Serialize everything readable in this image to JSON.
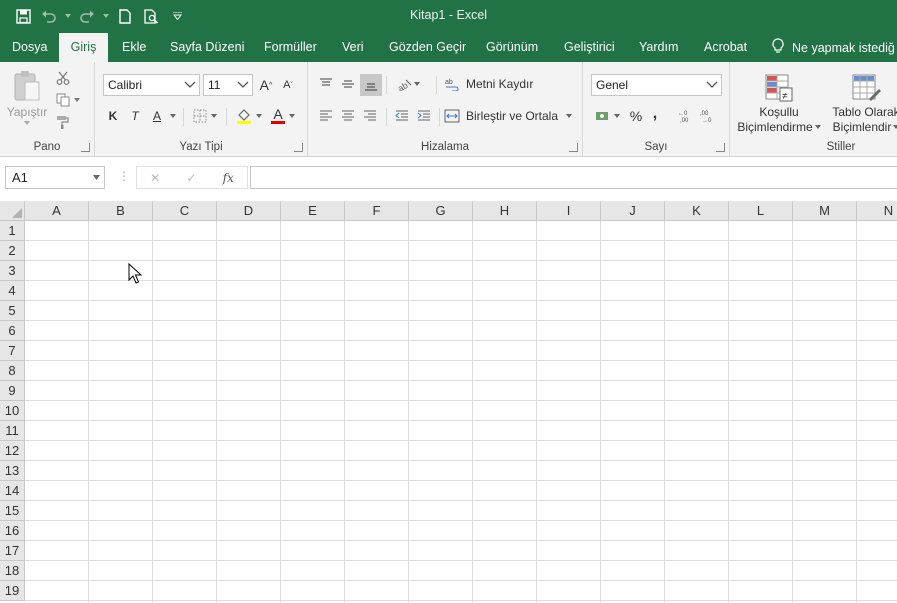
{
  "window": {
    "title": "Kitap1  -  Excel"
  },
  "quick_access": {
    "save": "save-icon",
    "undo": "undo-icon",
    "redo": "redo-icon",
    "new": "new-document-icon",
    "print_preview": "print-preview-icon",
    "customize": "customize-qat-icon"
  },
  "tabs": [
    "Dosya",
    "Giriş",
    "Ekle",
    "Sayfa Düzeni",
    "Formüller",
    "Veri",
    "Gözden Geçir",
    "Görünüm",
    "Geliştirici",
    "Yardım",
    "Acrobat"
  ],
  "active_tab": "Giriş",
  "tell_me": "Ne yapmak istediğ",
  "ribbon": {
    "clipboard": {
      "label": "Pano",
      "paste": "Yapıştır"
    },
    "font": {
      "label": "Yazı Tipi",
      "name": "Calibri",
      "size": "11",
      "bold": "K",
      "italic": "T",
      "underline": "A",
      "font_color": "A"
    },
    "alignment": {
      "label": "Hizalama",
      "wrap_text": "Metni Kaydır",
      "merge_center": "Birleştir ve Ortala"
    },
    "number": {
      "label": "Sayı",
      "format": "Genel",
      "percent": "%",
      "comma": ","
    },
    "styles": {
      "label": "Stiller",
      "conditional_1": "Koşullu",
      "conditional_2": "Biçimlendirme",
      "table_1": "Tablo Olarak",
      "table_2": "Biçimlendir"
    }
  },
  "formula_bar": {
    "name_box": "A1",
    "cancel": "✕",
    "enter": "✓",
    "fx": "fx",
    "value": ""
  },
  "sheet": {
    "columns": [
      "A",
      "B",
      "C",
      "D",
      "E",
      "F",
      "G",
      "H",
      "I",
      "J",
      "K",
      "L",
      "M",
      "N"
    ],
    "rows": [
      "1",
      "2",
      "3",
      "4",
      "5",
      "6",
      "7",
      "8",
      "9",
      "10",
      "11",
      "12",
      "13",
      "14",
      "15",
      "16",
      "17",
      "18",
      "19"
    ]
  },
  "colors": {
    "brand": "#217346",
    "ribbon_bg": "#f3f3f3",
    "header_bg": "#e6e6e6",
    "gridline": "#dcdcdc"
  }
}
